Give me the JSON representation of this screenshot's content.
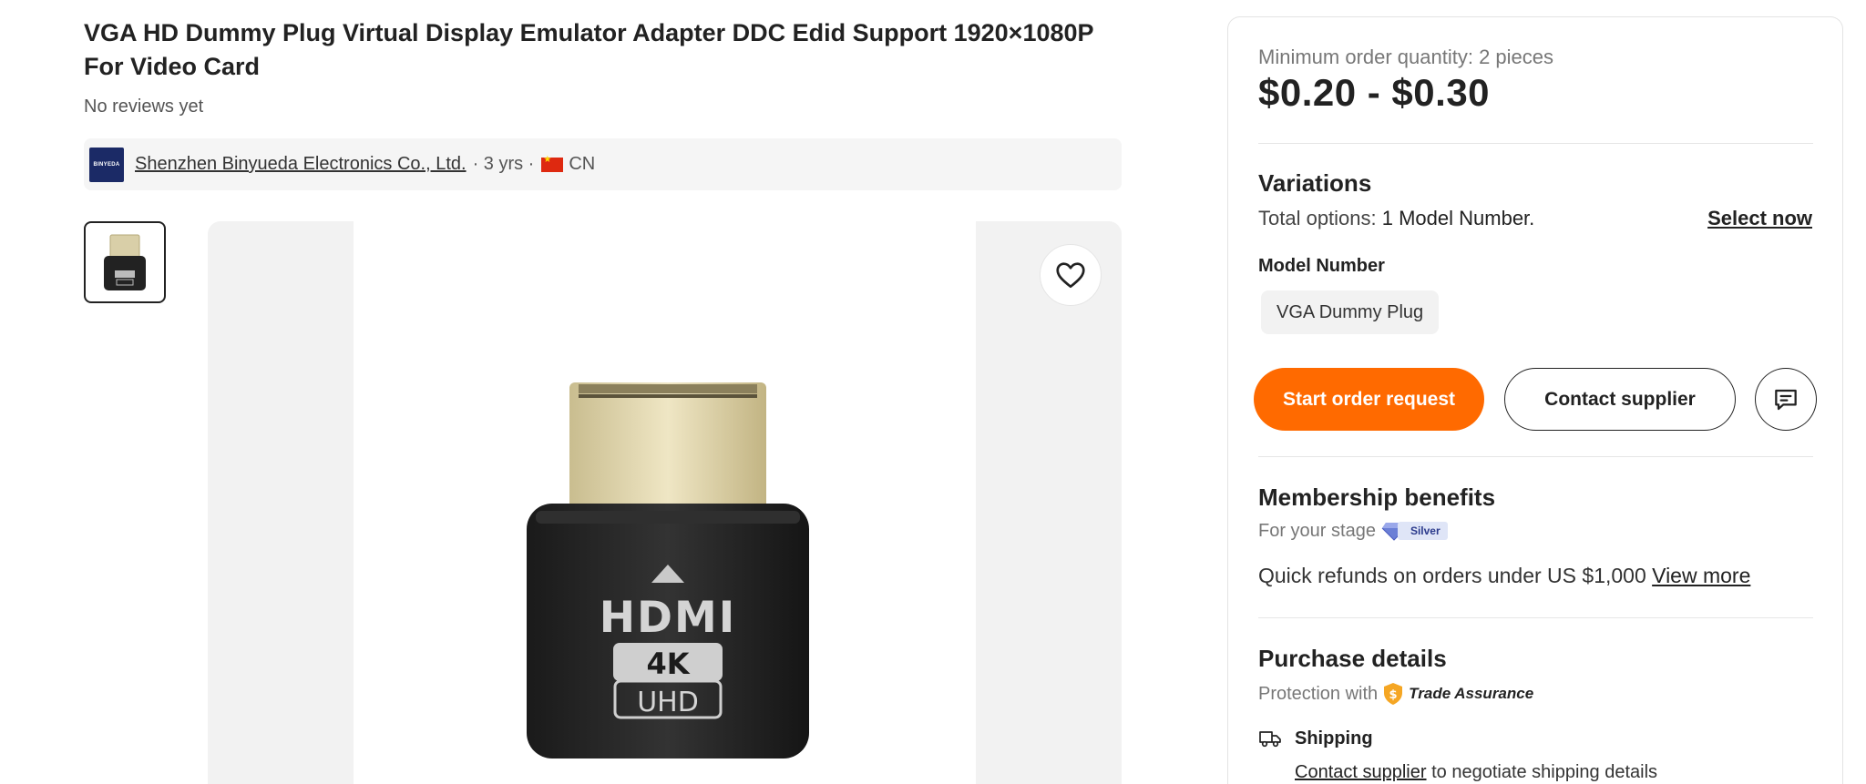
{
  "product": {
    "title": "VGA HD Dummy Plug Virtual Display Emulator Adapter DDC Edid Support 1920×1080P For Video Card",
    "reviews": "No reviews yet"
  },
  "supplier": {
    "logo_text": "BINYEDA",
    "name": "Shenzhen Binyueda Electronics Co., Ltd.",
    "years": " · 3 yrs ·",
    "country": "CN"
  },
  "gallery": {
    "connector_label": "HDMI",
    "badge_top": "4K",
    "badge_bottom": "UHD"
  },
  "pricing": {
    "moq": "Minimum order quantity: 2 pieces",
    "price_range": "$0.20 - $0.30"
  },
  "variations": {
    "heading": "Variations",
    "total_label": "Total options:",
    "total_value": " 1 Model Number.",
    "select_now": "Select now",
    "model_label": "Model Number",
    "model_option": "VGA Dummy Plug"
  },
  "actions": {
    "start_order": "Start order request",
    "contact_supplier": "Contact supplier"
  },
  "membership": {
    "heading": "Membership benefits",
    "stage_label": "For your stage",
    "stage_badge": "Silver",
    "refund_text": "Quick refunds on orders under US $1,000 ",
    "view_more": "View more"
  },
  "purchase": {
    "heading": "Purchase details",
    "protection_label": "Protection with",
    "trade_assurance": "Trade Assurance",
    "shipping_label": "Shipping",
    "shipping_link": "Contact supplier",
    "shipping_text": " to negotiate shipping details"
  },
  "colors": {
    "accent": "#ff6a00",
    "text": "#222222",
    "muted": "#777777",
    "silver_badge": "#dfe5f7",
    "trade_assurance": "#f5a623"
  },
  "icons": {
    "favorite": "heart-icon",
    "chat": "chat-icon",
    "shipping": "truck-icon",
    "trade_assurance": "shield-dollar-icon",
    "silver": "diamond-icon"
  }
}
